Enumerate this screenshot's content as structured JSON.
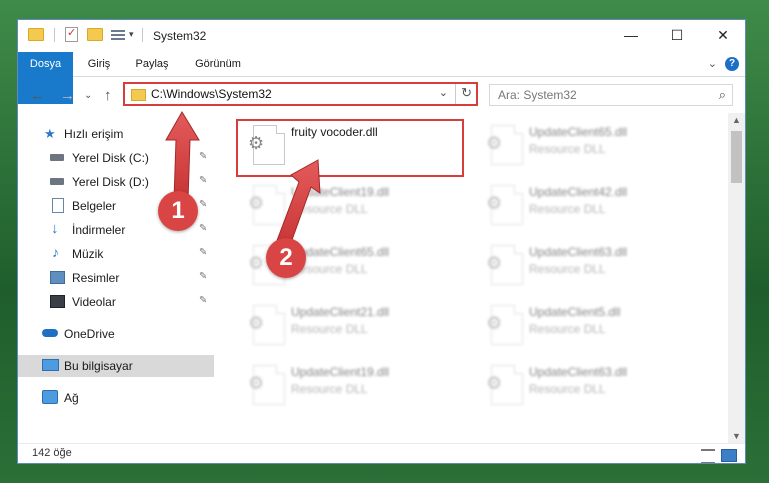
{
  "window": {
    "title": "System32",
    "controls": {
      "minimize": "—",
      "maximize": "☐",
      "close": "✕"
    }
  },
  "ribbon": {
    "tabs": [
      "Dosya",
      "Giriş",
      "Paylaş",
      "Görünüm"
    ],
    "collapse_chevron": "⌄",
    "help": "?"
  },
  "address": {
    "path": "C:\\Windows\\System32",
    "dropdown": "⌄",
    "refresh": "↻",
    "search_placeholder": "Ara: System32"
  },
  "nav": {
    "back": "←",
    "forward": "→",
    "recent": "⌄",
    "up": "↑",
    "items": [
      {
        "label": "Hızlı erişim",
        "icon": "star-icon",
        "pinned": false
      },
      {
        "label": "Yerel Disk (C:)",
        "icon": "drive-icon",
        "pinned": true
      },
      {
        "label": "Yerel Disk (D:)",
        "icon": "drive-icon",
        "pinned": true
      },
      {
        "label": "Belgeler",
        "icon": "document-icon",
        "pinned": true
      },
      {
        "label": "İndirmeler",
        "icon": "download-icon",
        "pinned": true
      },
      {
        "label": "Müzik",
        "icon": "music-icon",
        "pinned": true
      },
      {
        "label": "Resimler",
        "icon": "picture-icon",
        "pinned": true
      },
      {
        "label": "Videolar",
        "icon": "video-icon",
        "pinned": true
      },
      {
        "label": "OneDrive",
        "icon": "cloud-icon",
        "pinned": false
      },
      {
        "label": "Bu bilgisayar",
        "icon": "computer-icon",
        "pinned": false,
        "selected": true
      },
      {
        "label": "Ağ",
        "icon": "network-icon",
        "pinned": false
      }
    ],
    "pin_glyph": "📌"
  },
  "files": [
    {
      "name": "fruity vocoder.dll",
      "type": "",
      "highlighted": true
    },
    {
      "name": "UpdateClient65.dll",
      "type": "Resource DLL"
    },
    {
      "name": "UpdateClient19.dll",
      "type": "Resource DLL"
    },
    {
      "name": "UpdateClient42.dll",
      "type": "Resource DLL"
    },
    {
      "name": "UpdateClient65.dll",
      "type": "Resource DLL"
    },
    {
      "name": "UpdateClient63.dll",
      "type": "Resource DLL"
    },
    {
      "name": "UpdateClient21.dll",
      "type": "Resource DLL"
    },
    {
      "name": "UpdateClient5.dll",
      "type": "Resource DLL"
    },
    {
      "name": "UpdateClient19.dll",
      "type": "Resource DLL"
    },
    {
      "name": "UpdateClient63.dll",
      "type": "Resource DLL"
    }
  ],
  "status": {
    "item_count": "142 öğe"
  },
  "annotations": {
    "step1": "1",
    "step2": "2"
  },
  "colors": {
    "accent": "#1979ca",
    "highlight": "#d63d3d",
    "selected_nav": "#d9d9d9"
  }
}
